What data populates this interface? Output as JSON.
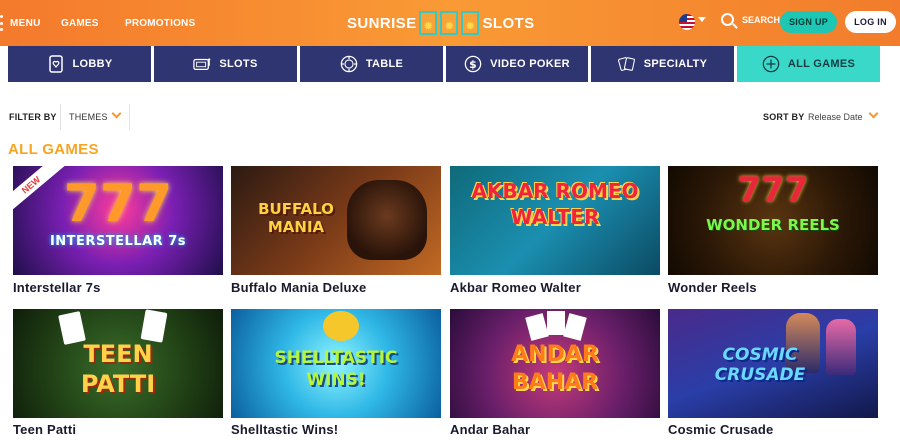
{
  "header": {
    "menu_label": "MENU",
    "nav": [
      "GAMES",
      "PROMOTIONS"
    ],
    "logo_left": "SUNRISE",
    "logo_right": "SLOTS",
    "search_label": "SEARCH",
    "signup_label": "SIGN UP",
    "login_label": "LOG IN",
    "accent": "#f58a30"
  },
  "tabs": [
    {
      "label": "LOBBY",
      "icon": "lobby-icon"
    },
    {
      "label": "SLOTS",
      "icon": "slot-machine-icon"
    },
    {
      "label": "TABLE",
      "icon": "chip-icon"
    },
    {
      "label": "VIDEO POKER",
      "icon": "dollar-icon"
    },
    {
      "label": "SPECIALTY",
      "icon": "cards-icon"
    },
    {
      "label": "ALL GAMES",
      "icon": "plus-icon",
      "active": true
    }
  ],
  "filter": {
    "label": "FILTER BY",
    "selected": "THEMES",
    "sort_label": "SORT BY",
    "sort_selected": "Release Date"
  },
  "section_title": "ALL GAMES",
  "games": [
    {
      "name": "Interstellar 7s",
      "badge": "NEW",
      "art_text": "INTERSTELLAR 7s"
    },
    {
      "name": "Buffalo Mania Deluxe",
      "art_text": "BUFFALO MANIA"
    },
    {
      "name": "Akbar Romeo Walter",
      "art_text": "AKBAR ROMEO WALTER"
    },
    {
      "name": "Wonder Reels",
      "art_text": "WONDER REELS"
    },
    {
      "name": "Teen Patti",
      "art_text": "TEEN PATTI"
    },
    {
      "name": "Shelltastic Wins!",
      "art_text": "SHELLTASTIC WINS!"
    },
    {
      "name": "Andar Bahar",
      "art_text": "ANDAR BAHAR"
    },
    {
      "name": "Cosmic Crusade",
      "art_text": "COSMIC CRUSADE"
    }
  ]
}
